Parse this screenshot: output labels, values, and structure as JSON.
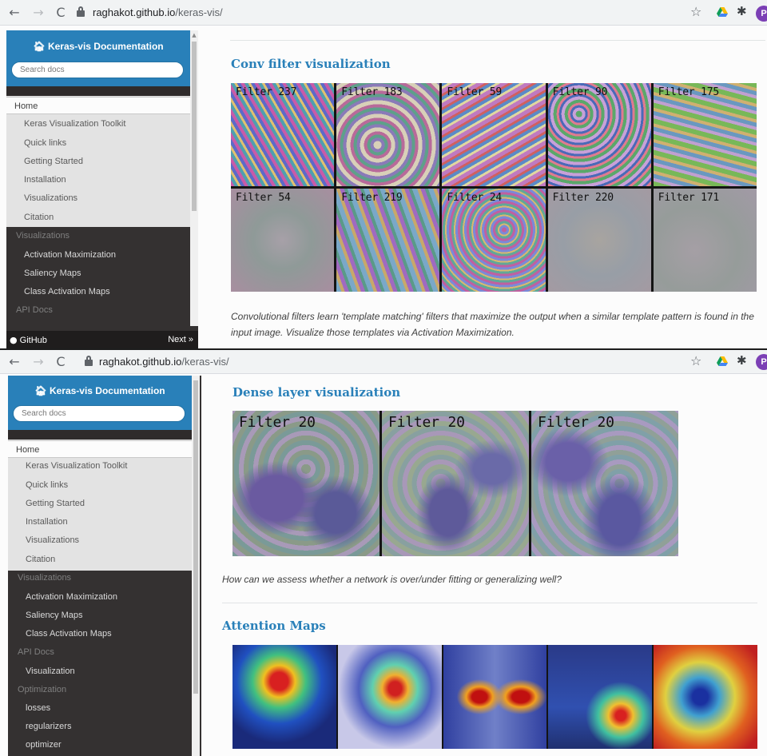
{
  "browser": {
    "url_host": "raghakot.github.io",
    "url_path": "/keras-vis/",
    "profile_initial": "P",
    "back_icon": "←",
    "forward_icon": "→",
    "reload_icon": "C",
    "star_icon": "☆",
    "extensions_icon": "✱"
  },
  "sidebar": {
    "title": "Keras-vis Documentation",
    "search_placeholder": "Search docs",
    "home_label": "Home",
    "home_children": [
      "Keras Visualization Toolkit",
      "Quick links",
      "Getting Started",
      "Installation",
      "Visualizations",
      "Citation"
    ],
    "visualizations_caption": "Visualizations",
    "visualizations_items": [
      "Activation Maximization",
      "Saliency Maps",
      "Class Activation Maps"
    ],
    "api_caption": "API Docs",
    "api_items": [
      "Visualization"
    ],
    "optimization_caption": "Optimization",
    "optimization_items": [
      "losses",
      "regularizers",
      "optimizer"
    ],
    "footer_github": "GitHub",
    "footer_next": "Next »"
  },
  "section_conv": {
    "title": "Conv filter visualization",
    "filters": [
      "Filter 237",
      "Filter 183",
      "Filter 59",
      "Filter 90",
      "Filter 175",
      "Filter 54",
      "Filter 219",
      "Filter 24",
      "Filter 220",
      "Filter 171"
    ],
    "caption": "Convolutional filters learn 'template matching' filters that maximize the output when a similar template pattern is found in the input image. Visualize those templates via Activation Maximization."
  },
  "section_dense": {
    "title": "Dense layer visualization",
    "filters": [
      "Filter 20",
      "Filter 20",
      "Filter 20"
    ],
    "caption": "How can we assess whether a network is over/under fitting or generalizing well?"
  },
  "section_attention": {
    "title": "Attention Maps"
  },
  "colors": {
    "accent": "#2980b9",
    "sidebar_dark": "#343131",
    "sidebar_light": "#e3e3e3"
  }
}
